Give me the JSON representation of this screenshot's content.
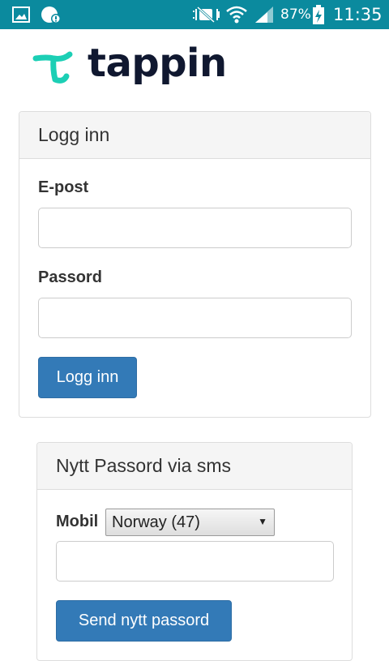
{
  "status_bar": {
    "battery_percent": "87%",
    "time": "11:35",
    "icons": [
      "gallery-icon",
      "notification-app-icon",
      "mute-icon",
      "wifi-icon",
      "signal-icon",
      "battery-charging-icon"
    ]
  },
  "brand": {
    "name": "tappin",
    "mark_color": "#1ccfb5",
    "text_color": "#101830"
  },
  "login": {
    "title": "Logg inn",
    "email_label": "E-post",
    "email_value": "",
    "password_label": "Passord",
    "password_value": "",
    "submit_label": "Logg inn"
  },
  "sms_reset": {
    "title": "Nytt Passord via sms",
    "mobile_label": "Mobil",
    "country_selected": "Norway (47)",
    "phone_value": "",
    "submit_label": "Send nytt passord"
  },
  "colors": {
    "status_bar": "#0b8a9e",
    "primary_button": "#337ab7"
  }
}
